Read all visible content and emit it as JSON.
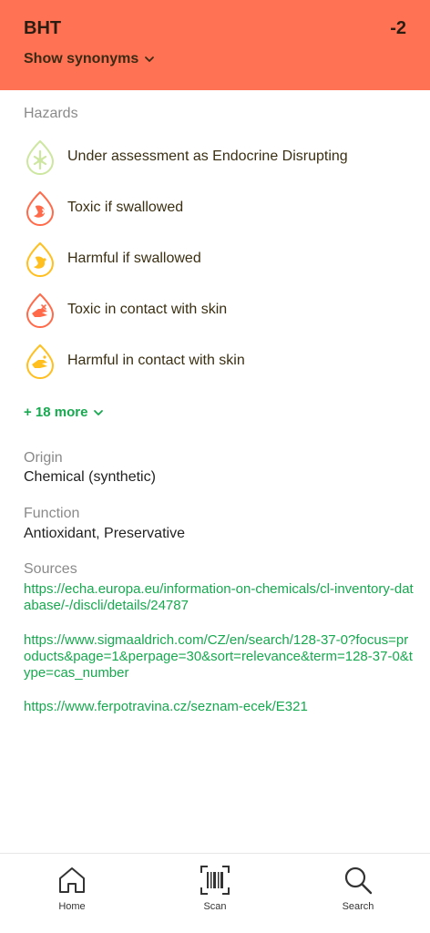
{
  "header": {
    "title": "BHT",
    "score": "-2",
    "synonyms_label": "Show synonyms",
    "background": "#ff7254"
  },
  "hazards": {
    "label": "Hazards",
    "items": [
      {
        "text": "Under assessment as Endocrine Disrupting",
        "icon": "endocrine-icon",
        "color": "#cde6a0"
      },
      {
        "text": "Toxic if swallowed",
        "icon": "stomach-toxic-icon",
        "color": "#ff6b4a"
      },
      {
        "text": "Harmful if swallowed",
        "icon": "stomach-harmful-icon",
        "color": "#ffbf1f"
      },
      {
        "text": "Toxic in contact with skin",
        "icon": "hand-toxic-icon",
        "color": "#ff6b4a"
      },
      {
        "text": "Harmful in contact with skin",
        "icon": "hand-harmful-icon",
        "color": "#ffbf1f"
      }
    ],
    "more_label": "+ 18 more"
  },
  "origin": {
    "label": "Origin",
    "value": "Chemical (synthetic)"
  },
  "function": {
    "label": "Function",
    "value": "Antioxidant, Preservative"
  },
  "sources": {
    "label": "Sources",
    "links": [
      "https://echa.europa.eu/information-on-chemicals/cl-inventory-database/-/discli/details/24787",
      "https://www.sigmaaldrich.com/CZ/en/search/128-37-0?focus=products&page=1&perpage=30&sort=relevance&term=128-37-0&type=cas_number",
      "https://www.ferpotravina.cz/seznam-ecek/E321"
    ]
  },
  "nav": {
    "home": "Home",
    "scan": "Scan",
    "search": "Search"
  },
  "colors": {
    "accent_green": "#17a94f",
    "toxic": "#ff6b4a",
    "harmful": "#ffbf1f"
  }
}
